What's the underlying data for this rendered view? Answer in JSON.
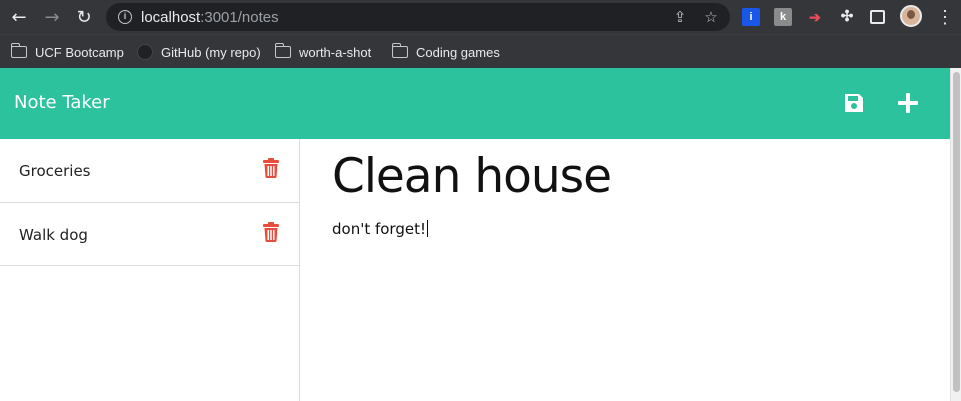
{
  "browser": {
    "url_host": "localhost",
    "url_path": ":3001/notes",
    "bookmarks": [
      {
        "label": "UCF Bootcamp",
        "icon": "folder-icon"
      },
      {
        "label": "GitHub (my repo)",
        "icon": "github-icon"
      },
      {
        "label": "worth-a-shot",
        "icon": "folder-icon"
      },
      {
        "label": "Coding games",
        "icon": "folder-icon"
      }
    ]
  },
  "app": {
    "brand": "Note Taker",
    "accent_color": "#2bc29d",
    "delete_color": "#e74c3c",
    "notes": [
      {
        "title": "Groceries"
      },
      {
        "title": "Walk dog"
      }
    ],
    "active_note": {
      "title": "Clean house",
      "text": "don't forget!"
    }
  }
}
